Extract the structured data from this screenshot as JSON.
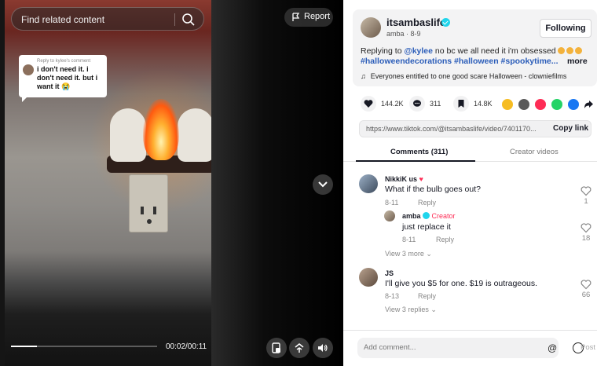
{
  "video": {
    "search_placeholder": "Find related content",
    "report_label": "Report",
    "reply_sticker": {
      "title": "Reply to kylee's comment",
      "body": "i don't need it. i don't need it. but i want it 😭"
    },
    "time_display": "00:02/00:11",
    "progress": 0.18
  },
  "post": {
    "username": "itsambaslife",
    "subline": "amba · 8-9",
    "follow_label": "Following",
    "caption": {
      "prefix": "Replying to ",
      "mention": "@kylee",
      "text": " no bc we all need it i'm obsessed",
      "tags": "#halloweendecorations #halloween #spookytime..."
    },
    "more_label": "more",
    "music": "Everyones entitled to one good scare Halloween - clowniefilms",
    "stats": {
      "likes": "144.2K",
      "comments": "311",
      "saves": "14.8K"
    },
    "link_url": "https://www.tiktok.com/@itsambaslife/video/7401170...",
    "copy_link_label": "Copy link"
  },
  "tabs": {
    "comments": "Comments (311)",
    "creator_videos": "Creator videos"
  },
  "comments": [
    {
      "user": "NikkiK us",
      "text": "What if the bulb goes out?",
      "date": "8-11",
      "reply_label": "Reply",
      "likes": "1",
      "reply": {
        "user": "amba",
        "creator_label": "Creator",
        "text": "just replace it",
        "date": "8-11",
        "reply_label": "Reply",
        "likes": "18"
      },
      "view_more": "View 3 more"
    },
    {
      "user": "JS",
      "text": "I'll give you $5 for one. $19 is outrageous.",
      "date": "8-13",
      "reply_label": "Reply",
      "likes": "66",
      "view_more": "View 3 replies"
    }
  ],
  "footer": {
    "input_placeholder": "Add comment...",
    "mention_symbol": "@",
    "post_label": "Post"
  },
  "colors": {
    "accent": "#fe2c55",
    "link": "#2b5db9",
    "verified": "#20d5ec"
  }
}
